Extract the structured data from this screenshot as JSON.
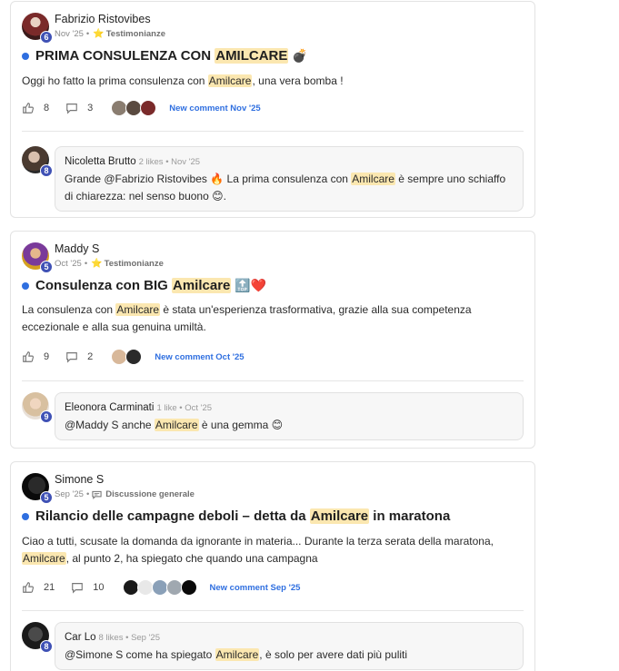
{
  "posts": [
    {
      "author": "Fabrizio Ristovibes",
      "level": "6",
      "date": "Nov '25",
      "category": "Testimonianze",
      "category_icon": "star-icon",
      "title_pre": "PRIMA CONSULENZA CON ",
      "title_hl": "AMILCARE",
      "title_post": "",
      "title_emoji": "💣",
      "body_pre": "Oggi ho fatto la prima consulenza con ",
      "body_hl": "Amilcare",
      "body_post": ", una vera bomba !",
      "likes": "8",
      "comments": "3",
      "new_comment": "New comment Nov '25",
      "comment": {
        "author": "Nicoletta Brutto",
        "level": "8",
        "meta": "2 likes • Nov '25",
        "text_pre": "Grande @Fabrizio Ristovibes 🔥 La prima consulenza con ",
        "text_hl": "Amilcare",
        "text_post": " è sempre uno schiaffo di chiarezza: nel senso buono 😊."
      }
    },
    {
      "author": "Maddy S",
      "level": "5",
      "date": "Oct '25",
      "category": "Testimonianze",
      "category_icon": "star-icon",
      "title_pre": "Consulenza con BIG ",
      "title_hl": "Amilcare",
      "title_post": "",
      "title_emoji": "🔝❤️",
      "body_pre": "La consulenza con ",
      "body_hl": "Amilcare",
      "body_post": " è stata un'esperienza trasformativa, grazie alla sua competenza eccezionale e alla sua genuina umiltà.",
      "likes": "9",
      "comments": "2",
      "new_comment": "New comment Oct '25",
      "comment": {
        "author": "Eleonora Carminati",
        "level": "9",
        "meta": "1 like • Oct '25",
        "text_pre": "@Maddy S anche ",
        "text_hl": "Amilcare",
        "text_post": " è una gemma 😊"
      }
    },
    {
      "author": "Simone S",
      "level": "5",
      "date": "Sep '25",
      "category": "Discussione generale",
      "category_icon": "speech-bubble-icon",
      "title_pre": "Rilancio delle campagne deboli – detta da ",
      "title_hl": "Amilcare",
      "title_post": " in maratona",
      "title_emoji": "",
      "body_pre": "Ciao a tutti, scusate la domanda da ignorante in materia... Durante la terza serata della maratona, ",
      "body_hl": "Amilcare",
      "body_post": ", al punto 2, ha spiegato che quando una campagna",
      "likes": "21",
      "comments": "10",
      "new_comment": "New comment Sep '25",
      "comment": {
        "author": "Car Lo",
        "level": "8",
        "meta": "8 likes • Sep '25",
        "text_pre": "@Simone S come ha spiegato ",
        "text_hl": "Amilcare",
        "text_post": ", è solo per avere dati più puliti"
      }
    }
  ],
  "colors": {
    "accent": "#2f6fe0",
    "highlight": "#fbe7b0",
    "level_badge": "#3f51b5"
  }
}
